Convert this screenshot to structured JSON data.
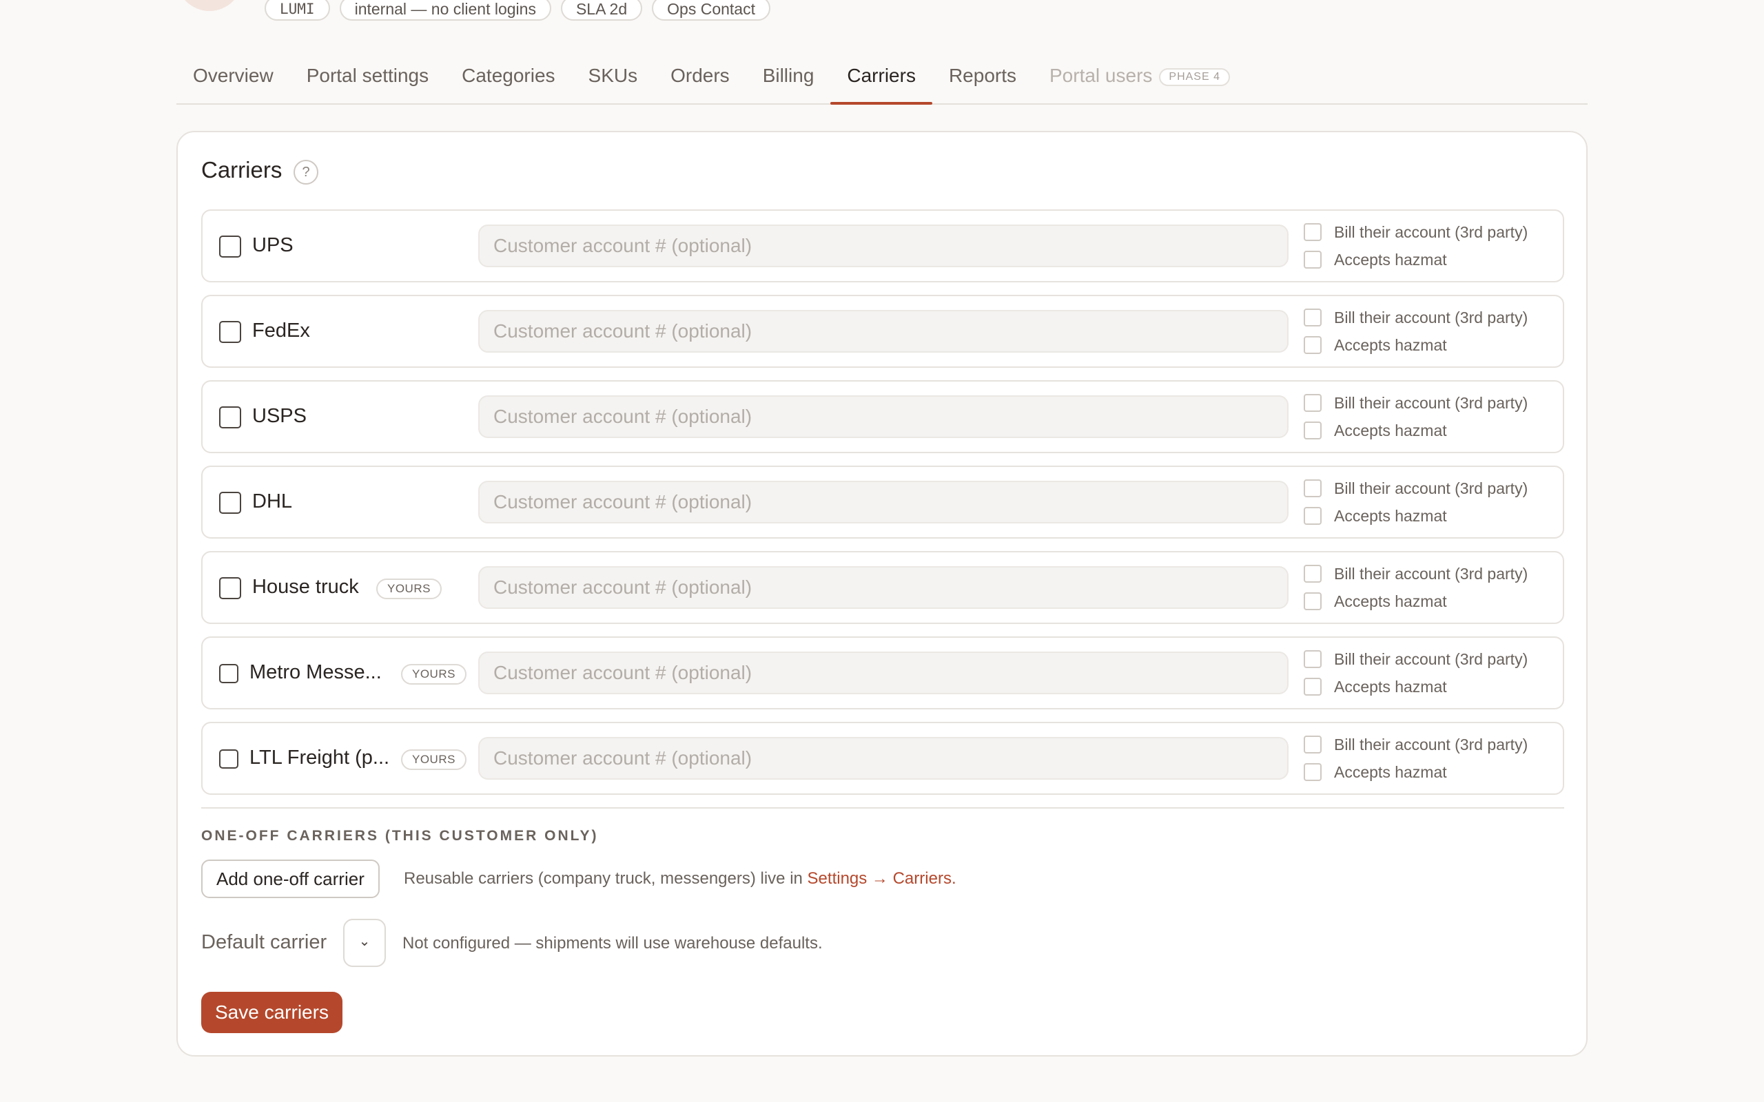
{
  "header": {
    "chips": [
      "LUMI",
      "internal — no client logins",
      "SLA 2d",
      "Ops Contact"
    ]
  },
  "tabs": [
    {
      "label": "Overview"
    },
    {
      "label": "Portal settings"
    },
    {
      "label": "Categories"
    },
    {
      "label": "SKUs"
    },
    {
      "label": "Orders"
    },
    {
      "label": "Billing"
    },
    {
      "label": "Carriers",
      "active": true
    },
    {
      "label": "Reports"
    },
    {
      "label": "Portal users",
      "disabled": true,
      "badge": "PHASE 4"
    }
  ],
  "card": {
    "title": "Carriers",
    "help_glyph": "?",
    "account_placeholder": "Customer account # (optional)",
    "bill_label": "Bill their account (3rd party)",
    "hazmat_label": "Accepts hazmat",
    "carriers": [
      {
        "name": "UPS",
        "badge": ""
      },
      {
        "name": "FedEx",
        "badge": ""
      },
      {
        "name": "USPS",
        "badge": ""
      },
      {
        "name": "DHL",
        "badge": ""
      },
      {
        "name": "House truck",
        "badge": "YOURS"
      },
      {
        "name": "Metro Messe...",
        "badge": "YOURS"
      },
      {
        "name": "LTL Freight (p...",
        "badge": "YOURS"
      }
    ],
    "oneoff_section_label": "ONE-OFF CARRIERS (THIS CUSTOMER ONLY)",
    "add_oneoff_label": "Add one-off carrier",
    "reuse_note_prefix": "Reusable carriers (company truck, messengers) live in ",
    "reuse_note_link": "Settings → Carriers.",
    "default_carrier_label": "Default carrier",
    "default_select_glyph": "⌄",
    "default_note": "Not configured — shipments will use warehouse defaults.",
    "save_label": "Save carriers"
  },
  "colors": {
    "accent": "#b5482c",
    "background": "#faf9f7"
  }
}
